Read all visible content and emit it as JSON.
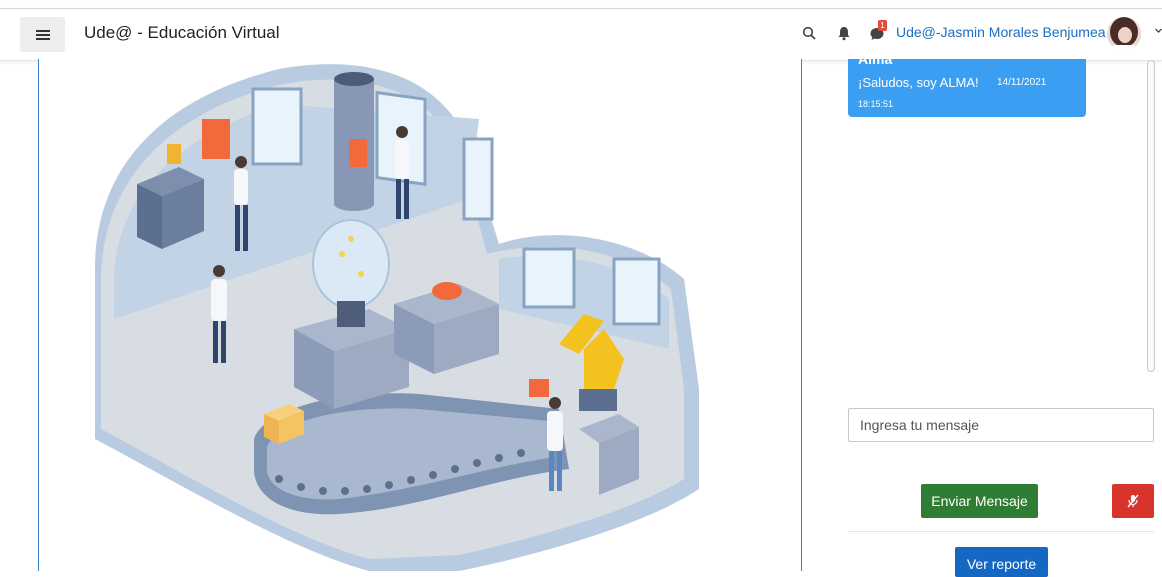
{
  "header": {
    "site_title": "Ude@ - Educación Virtual",
    "notification_count": "1",
    "user_name": "Ude@-Jasmin Morales Benjumea"
  },
  "chat": {
    "messages": [
      {
        "author": "Alma",
        "text": "¡Saludos, soy ALMA!",
        "date": "14/11/2021",
        "time": "18:15:51"
      }
    ],
    "input_placeholder": "Ingresa tu mensaje",
    "send_label": "Enviar Mensaje",
    "report_label": "Ver reporte"
  },
  "colors": {
    "chat_bubble": "#3a9ff2",
    "send_button": "#2f7d32",
    "mic_button": "#d9342b",
    "report_button": "#1468c4",
    "user_link": "#1b6ec2"
  },
  "icons": [
    "hamburger-icon",
    "search-icon",
    "bell-icon",
    "chat-bubble-icon",
    "chevron-down-icon",
    "mic-off-icon"
  ]
}
